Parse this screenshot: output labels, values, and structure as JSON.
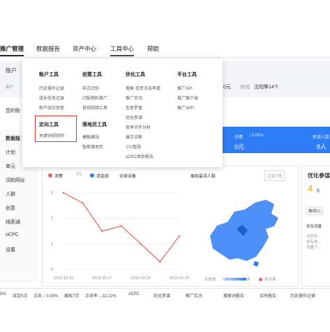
{
  "nav": {
    "items": [
      "推广管理",
      "数据报告",
      "资产中心",
      "工具中心",
      "帮助"
    ]
  },
  "top_row": {
    "account_label": "账户",
    "account_sub": "客户",
    "budget_text": "0元",
    "region_label": "地域",
    "region_value": "沈阳等14个"
  },
  "dropdown": {
    "columns": [
      {
        "header": "账户工具",
        "items": [
          "历史操作记录",
          "成长任务记录",
          "新产品实验室"
        ]
      },
      {
        "header": "创意工具",
        "items": [
          "样式识别",
          "闪投物料推广",
          "慧视视频工具"
        ]
      },
      {
        "header": "优化工具",
        "items": [
          "搜索-百意点击率提",
          "推广实况",
          "生意罗盘",
          "优化参谋",
          "竞争对手分析",
          "展示诊断",
          "小U智投",
          "oCPC体检报告"
        ]
      },
      {
        "header": "平台工具",
        "items": [
          "推广API",
          "推广客户端",
          "推广APP"
        ]
      }
    ],
    "section2": [
      {
        "header": "定向工具",
        "items": [
          "关键词规划师"
        ]
      },
      {
        "header": "落地页工具",
        "items": [
          "模板建站",
          "智能落地页"
        ]
      }
    ]
  },
  "left_label": "您的账",
  "sidebar": {
    "items": [
      "数据报",
      "计划",
      "单元",
      "词和网址",
      "人群",
      "创意",
      "线索通",
      "oCPC",
      "设置"
    ]
  },
  "blue_banner": {
    "stat1_label": "消费",
    "stat1_change": "↓ 0.00%",
    "stat1_value": "0元",
    "stat2_label": "新增人数",
    "stat2_value": "8人"
  },
  "chart_header": {
    "legend1": "消费",
    "vs": "VS",
    "legend2": "请选择",
    "device": "全部设备",
    "region_select": "展现最活人数",
    "range": "过去7天"
  },
  "chart_data": {
    "type": "line",
    "x": [
      "2019-10-15",
      "2019-10-16",
      "2019-10-17",
      "2019-10-18",
      "2019-10-19",
      "2019-10-20",
      "2019-10-21"
    ],
    "series": [
      {
        "name": "消费",
        "values": [
          3,
          2.6,
          1.5,
          1.7,
          1.0,
          0.3,
          1.3
        ]
      }
    ],
    "y_ticks": [
      "3",
      "2",
      "1",
      "0"
    ],
    "x_ticks": [
      "2019-10-15",
      "2019-10-17",
      "2019-10-19",
      "2019-10-21"
    ],
    "ylim": [
      0,
      3
    ]
  },
  "map_legend": {
    "none": "无投放",
    "few": "少",
    "many": "多",
    "new": "新访客"
  },
  "right_panel": {
    "title": "优化参谋",
    "score": "4",
    "score_unit": "条",
    "tab": "展现(1)",
    "item1": "优化流量",
    "item2a": "还好到...",
    "item2b": "或有效...",
    "item2c": "流量下..."
  },
  "bottom_bar": {
    "items": [
      "0%",
      "成交0次",
      "点击 ↓ 0.00%",
      "展现7次",
      "点击率 ↓ 22.22%",
      "oCPC",
      "优化参谋",
      "推广实况",
      "搜索词报告",
      "实时报告",
      "历史操作记录"
    ]
  },
  "colors": {
    "accent": "#2f7df6",
    "line": "#e5645a",
    "map": "#2f7df6"
  }
}
